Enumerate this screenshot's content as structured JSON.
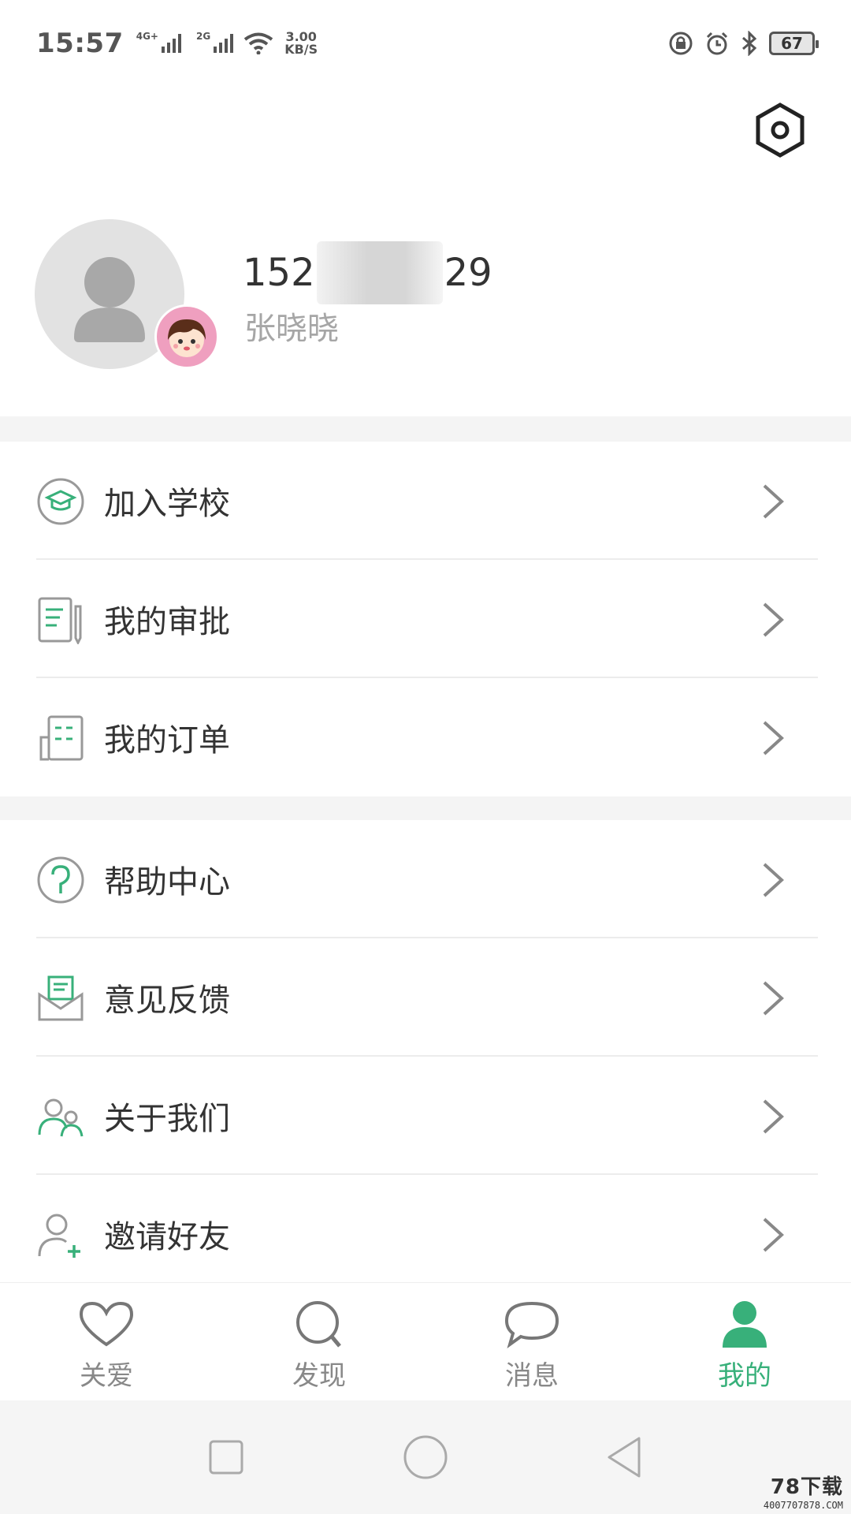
{
  "status_bar": {
    "time": "15:57",
    "sim1_tag": "4G+",
    "sim2_tag": "2G",
    "net_speed_value": "3.00",
    "net_speed_unit": "KB/S",
    "battery": "67"
  },
  "profile": {
    "phone_prefix": "152",
    "phone_suffix": "29",
    "name": "张晓晓"
  },
  "menu_group_1": [
    {
      "label": "加入学校",
      "icon": "graduation-cap-icon"
    },
    {
      "label": "我的审批",
      "icon": "approval-doc-icon"
    },
    {
      "label": "我的订单",
      "icon": "order-list-icon"
    }
  ],
  "menu_group_2": [
    {
      "label": "帮助中心",
      "icon": "help-icon"
    },
    {
      "label": "意见反馈",
      "icon": "feedback-envelope-icon"
    },
    {
      "label": "关于我们",
      "icon": "people-icon"
    },
    {
      "label": "邀请好友",
      "icon": "add-friend-icon"
    }
  ],
  "tabbar": {
    "tabs": [
      {
        "label": "关爱",
        "icon": "heart-icon"
      },
      {
        "label": "发现",
        "icon": "search-icon"
      },
      {
        "label": "消息",
        "icon": "chat-bubble-icon"
      },
      {
        "label": "我的",
        "icon": "person-icon"
      }
    ],
    "active_index": 3
  },
  "colors": {
    "accent": "#38b07a",
    "icon_gray": "#888888",
    "text": "#333333",
    "subtext": "#a6a6a6",
    "gap": "#f4f4f4"
  },
  "watermark": {
    "text": "78下载",
    "url": "4007707878.COM"
  }
}
